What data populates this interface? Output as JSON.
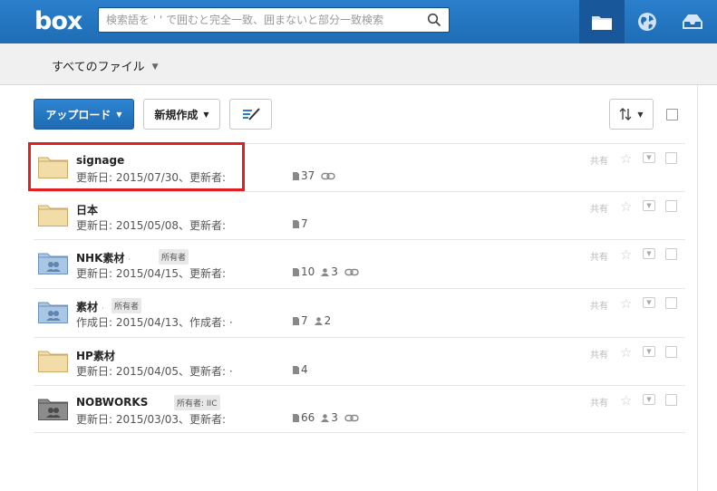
{
  "header": {
    "logo": "box",
    "search_placeholder": "検索語を ' ' で囲むと完全一致、囲まないと部分一致検索",
    "nav": [
      "folder-icon",
      "globe-icon",
      "inbox-icon"
    ]
  },
  "breadcrumb": {
    "label": "すべてのファイル"
  },
  "toolbar": {
    "upload_label": "アップロード",
    "new_label": "新規作成"
  },
  "files": [
    {
      "name": "signage",
      "tag": "",
      "meta": "更新日: 2015/07/30、更新者:",
      "files": "37",
      "collabs": "",
      "link": true,
      "folder": "plain",
      "share": "共有"
    },
    {
      "name": "日本",
      "tag": "",
      "meta": "更新日: 2015/05/08、更新者:",
      "files": "7",
      "collabs": "",
      "link": false,
      "folder": "plain",
      "share": "共有"
    },
    {
      "name": "NHK素材",
      "tag": "所有者",
      "meta": "更新日: 2015/04/15、更新者:",
      "files": "10",
      "collabs": "3",
      "link": true,
      "folder": "shared",
      "share": "共有"
    },
    {
      "name": "素材",
      "tag": "所有者",
      "meta": "作成日: 2015/04/13、作成者: ·",
      "files": "7",
      "collabs": "2",
      "link": false,
      "folder": "shared",
      "share": "共有"
    },
    {
      "name": "HP素材",
      "tag": "",
      "meta": "更新日: 2015/04/05、更新者: ·",
      "files": "4",
      "collabs": "",
      "link": false,
      "folder": "plain",
      "share": "共有"
    },
    {
      "name": "NOBWORKS",
      "tag": "所有者: IIC",
      "meta": "更新日: 2015/03/03、更新者:",
      "files": "66",
      "collabs": "3",
      "link": true,
      "folder": "external",
      "share": "共有"
    }
  ],
  "colors": {
    "header_bg": "#1e6db5",
    "header_active": "#17579a",
    "upload_btn": "#2a7dc9",
    "highlight": "#e02020",
    "folder_plain": "#f2dca8",
    "folder_shared": "#a9c6e4",
    "folder_external": "#8c8c8c"
  }
}
